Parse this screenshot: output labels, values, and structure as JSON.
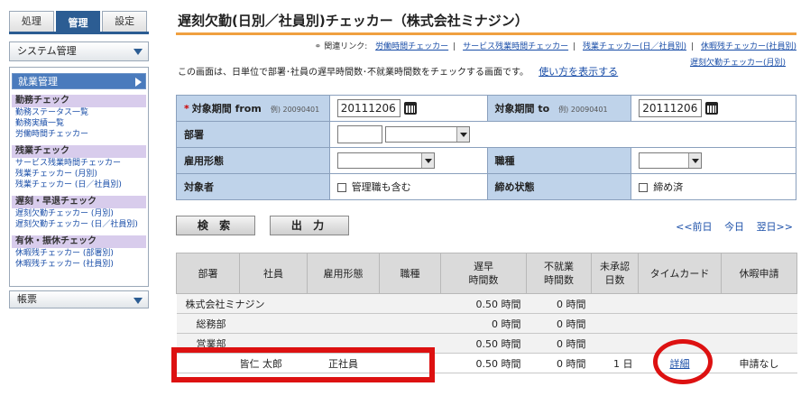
{
  "sidebar": {
    "tabs": [
      {
        "label": "処理",
        "active": false
      },
      {
        "label": "管理",
        "active": true
      },
      {
        "label": "設定",
        "active": false
      }
    ],
    "system_menu": "システム管理",
    "work_menu": "就業管理",
    "categories": [
      {
        "title": "勤務チェック",
        "links": [
          "勤務ステータス一覧",
          "勤務実績一覧",
          "労働時間チェッカー"
        ]
      },
      {
        "title": "残業チェック",
        "links": [
          "サービス残業時間チェッカー",
          "残業チェッカー (月別)",
          "残業チェッカー (日／社員別)"
        ]
      },
      {
        "title": "遅刻・早退チェック",
        "links": [
          "遅刻欠勤チェッカー (月別)",
          "遅刻欠勤チェッカー (日／社員別)"
        ]
      },
      {
        "title": "有休・振休チェック",
        "links": [
          "休暇残チェッカー (部署別)",
          "休暇残チェッカー (社員別)"
        ]
      }
    ],
    "ledger_menu": "帳票"
  },
  "main": {
    "title": "遅刻欠勤(日別／社員別)チェッカー（株式会社ミナジン）",
    "related_label": "関連リンク:",
    "related_links": [
      "労働時間チェッカー",
      "サービス残業時間チェッカー",
      "残業チェッカー(日／社員別)",
      "休暇残チェッカー(社員別)"
    ],
    "related_link_extra": "遅刻欠勤チェッカー(月別)",
    "description": "この画面は、日単位で部署･社員の遅早時間数･不就業時間数をチェックする画面です。",
    "howto_link": "使い方を表示する"
  },
  "search": {
    "period_from_label": "対象期間 from",
    "period_from_example": "例) 20090401",
    "period_from_value": "20111206",
    "period_to_label": "対象期間 to",
    "period_to_example": "例) 20090401",
    "period_to_value": "20111206",
    "dept_label": "部署",
    "employment_label": "雇用形態",
    "jobtype_label": "職種",
    "target_label": "対象者",
    "manager_checkbox": "管理職も含む",
    "closing_label": "締め状態",
    "closing_checkbox": "締め済"
  },
  "actions": {
    "search": "検 索",
    "output": "出 力",
    "prev_day": "<<前日",
    "today": "今日",
    "next_day": "翌日>>"
  },
  "results": {
    "headers": {
      "dept": "部署",
      "employee": "社員",
      "employment": "雇用形態",
      "jobtype": "職種",
      "late_early_1": "遅早",
      "late_early_2": "時間数",
      "absent_1": "不就業",
      "absent_2": "時間数",
      "unapproved_1": "未承認",
      "unapproved_2": "日数",
      "timecard": "タイムカード",
      "leave": "休暇申請"
    },
    "rows": [
      {
        "name": "株式会社ミナジン",
        "late": "0.50 時間",
        "absent": "0 時間"
      },
      {
        "name": "総務部",
        "late": "0 時間",
        "absent": "0 時間"
      },
      {
        "name": "営業部",
        "late": "0.50 時間",
        "absent": "0 時間"
      }
    ],
    "employee_row": {
      "employee": "皆仁 太郎",
      "employment": "正社員",
      "late": "0.50 時間",
      "absent": "0 時間",
      "unapproved": "1 日",
      "timecard": "詳細",
      "leave": "申請なし"
    }
  }
}
